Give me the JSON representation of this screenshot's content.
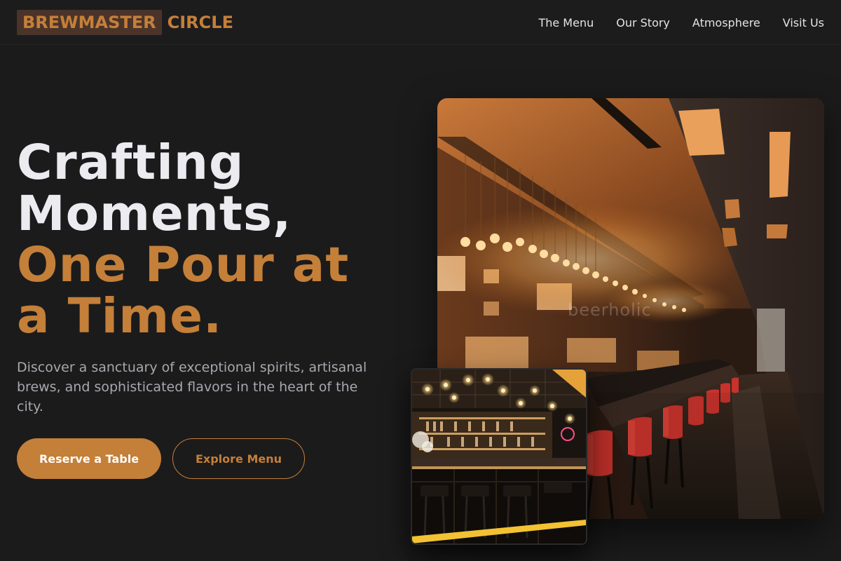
{
  "brand": {
    "highlight": "BREWMASTER",
    "rest": "CIRCLE",
    "accent_color": "#c47f39"
  },
  "nav": {
    "items": [
      {
        "label": "The Menu"
      },
      {
        "label": "Our Story"
      },
      {
        "label": "Atmosphere"
      },
      {
        "label": "Visit Us"
      }
    ]
  },
  "hero": {
    "headline_line1": "Crafting",
    "headline_line2": "Moments,",
    "headline_accent_line1": "One Pour at",
    "headline_accent_line2": "a Time.",
    "subtext": "Discover a sanctuary of exceptional spirits, artisanal brews, and sophisticated flavors in the heart of the city.",
    "primary_cta": "Reserve a Table",
    "secondary_cta": "Explore Menu"
  },
  "images": {
    "main_watermark": "beerholic"
  },
  "colors": {
    "background": "#1b1b1c",
    "text": "#ececef",
    "muted": "#a8a8ae"
  }
}
